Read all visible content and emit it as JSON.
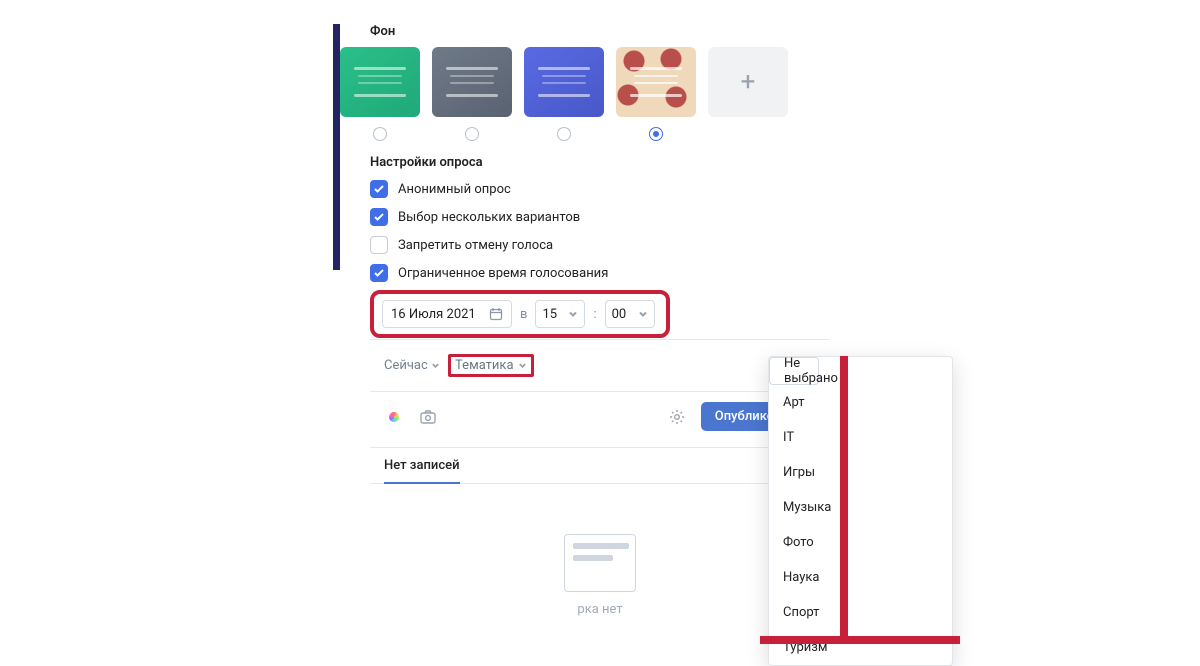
{
  "background": {
    "label": "Фон",
    "selected_index": 3
  },
  "settings": {
    "label": "Настройки опроса",
    "options": [
      {
        "label": "Анонимный опрос",
        "checked": true
      },
      {
        "label": "Выбор нескольких вариантов",
        "checked": true
      },
      {
        "label": "Запретить отмену голоса",
        "checked": false
      },
      {
        "label": "Ограниченное время голосования",
        "checked": true
      }
    ]
  },
  "datetime": {
    "date": "16 Июля 2021",
    "at_label": "в",
    "hour": "15",
    "minute": "00"
  },
  "schedule": {
    "now_label": "Сейчас",
    "topic_label": "Тематика"
  },
  "actions": {
    "publish": "Опубликовать"
  },
  "tabs": {
    "no_posts": "Нет записей"
  },
  "empty": {
    "text": "рка нет"
  },
  "dropdown": {
    "items": [
      "Не выбрано",
      "Арт",
      "IT",
      "Игры",
      "Музыка",
      "Фото",
      "Наука",
      "Спорт",
      "Туризм"
    ],
    "selected": 0
  }
}
